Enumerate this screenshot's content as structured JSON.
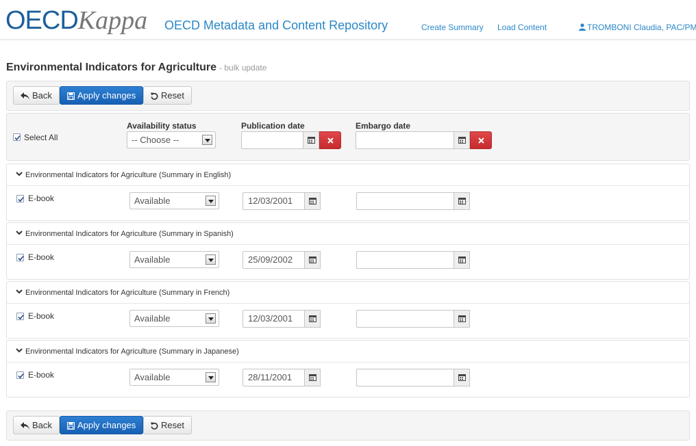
{
  "header": {
    "logo_oecd": "OECD",
    "logo_kappa": "Kappa",
    "app_title": "OECD Metadata and Content Repository",
    "nav": [
      {
        "label": "Create Summary"
      },
      {
        "label": "Load Content"
      }
    ],
    "user": {
      "label": "TROMBONI Claudia, PAC/PM",
      "icon": "user-icon"
    }
  },
  "page": {
    "title": "Environmental Indicators for Agriculture",
    "subtitle": "- bulk update"
  },
  "toolbar": {
    "back_label": "Back",
    "apply_label": "Apply changes",
    "reset_label": "Reset"
  },
  "filters": {
    "select_all_label": "Select All",
    "select_all_checked": true,
    "availability_label": "Availability status",
    "availability_value": "-- Choose --",
    "publication_label": "Publication date",
    "publication_value": "",
    "embargo_label": "Embargo date",
    "embargo_value": ""
  },
  "items": [
    {
      "title": "Environmental Indicators for Agriculture (Summary in English)",
      "format": "E-book",
      "checked": true,
      "availability": "Available",
      "publication_date": "12/03/2001",
      "embargo_date": ""
    },
    {
      "title": "Environmental Indicators for Agriculture (Summary in Spanish)",
      "format": "E-book",
      "checked": true,
      "availability": "Available",
      "publication_date": "25/09/2002",
      "embargo_date": ""
    },
    {
      "title": "Environmental Indicators for Agriculture (Summary in French)",
      "format": "E-book",
      "checked": true,
      "availability": "Available",
      "publication_date": "12/03/2001",
      "embargo_date": ""
    },
    {
      "title": "Environmental Indicators for Agriculture (Summary in Japanese)",
      "format": "E-book",
      "checked": true,
      "availability": "Available",
      "publication_date": "28/11/2001",
      "embargo_date": ""
    }
  ],
  "colors": {
    "brand_blue": "#1d5f9a",
    "link_blue": "#2a87c8",
    "primary_button": "#1760b3",
    "danger_button": "#c62b2e"
  }
}
